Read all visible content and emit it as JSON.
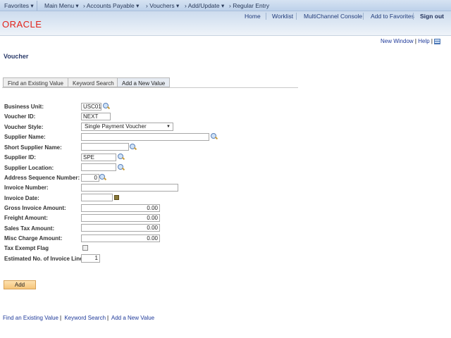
{
  "nav": {
    "favorites": "Favorites ▾",
    "main_menu": "Main Menu ▾",
    "crumbs": [
      "› Accounts Payable ▾",
      "› Vouchers ▾",
      "› Add/Update ▾",
      "› Regular Entry"
    ]
  },
  "header": {
    "links": [
      "Home",
      "Worklist",
      "MultiChannel Console",
      "Add to Favorites"
    ],
    "sign_out": "Sign out",
    "logo": "ORACLE"
  },
  "toolbar": {
    "new_window": "New Window",
    "help": "Help",
    "customize_icon": "grid-icon"
  },
  "page_title": "Voucher",
  "tabs": [
    {
      "label": "Find an Existing Value"
    },
    {
      "label": "Keyword Search"
    },
    {
      "label": "Add a New Value",
      "active": true
    }
  ],
  "form": {
    "business_unit": {
      "label": "Business Unit:",
      "value": "USC01"
    },
    "voucher_id": {
      "label": "Voucher ID:",
      "value": "NEXT"
    },
    "voucher_style": {
      "label": "Voucher Style:",
      "value": "Single Payment Voucher"
    },
    "supplier_name": {
      "label": "Supplier Name:",
      "value": ""
    },
    "short_supplier_name": {
      "label": "Short Supplier Name:",
      "value": ""
    },
    "supplier_id": {
      "label": "Supplier ID:",
      "value": "SPE"
    },
    "supplier_location": {
      "label": "Supplier Location:",
      "value": ""
    },
    "address_seq": {
      "label": "Address Sequence Number:",
      "value": "0"
    },
    "invoice_number": {
      "label": "Invoice Number:",
      "value": ""
    },
    "invoice_date": {
      "label": "Invoice Date:",
      "value": ""
    },
    "gross_amount": {
      "label": "Gross Invoice Amount:",
      "value": "0.00"
    },
    "freight_amount": {
      "label": "Freight Amount:",
      "value": "0.00"
    },
    "sales_tax_amount": {
      "label": "Sales Tax Amount:",
      "value": "0.00"
    },
    "misc_charge_amount": {
      "label": "Misc Charge Amount:",
      "value": "0.00"
    },
    "tax_exempt": {
      "label": "Tax Exempt Flag",
      "checked": false
    },
    "est_lines": {
      "label": "Estimated No. of Invoice Lines:",
      "value": "1"
    }
  },
  "add_button": "Add",
  "bottom_links": [
    "Find an Existing Value",
    "Keyword Search",
    "Add a New Value"
  ]
}
